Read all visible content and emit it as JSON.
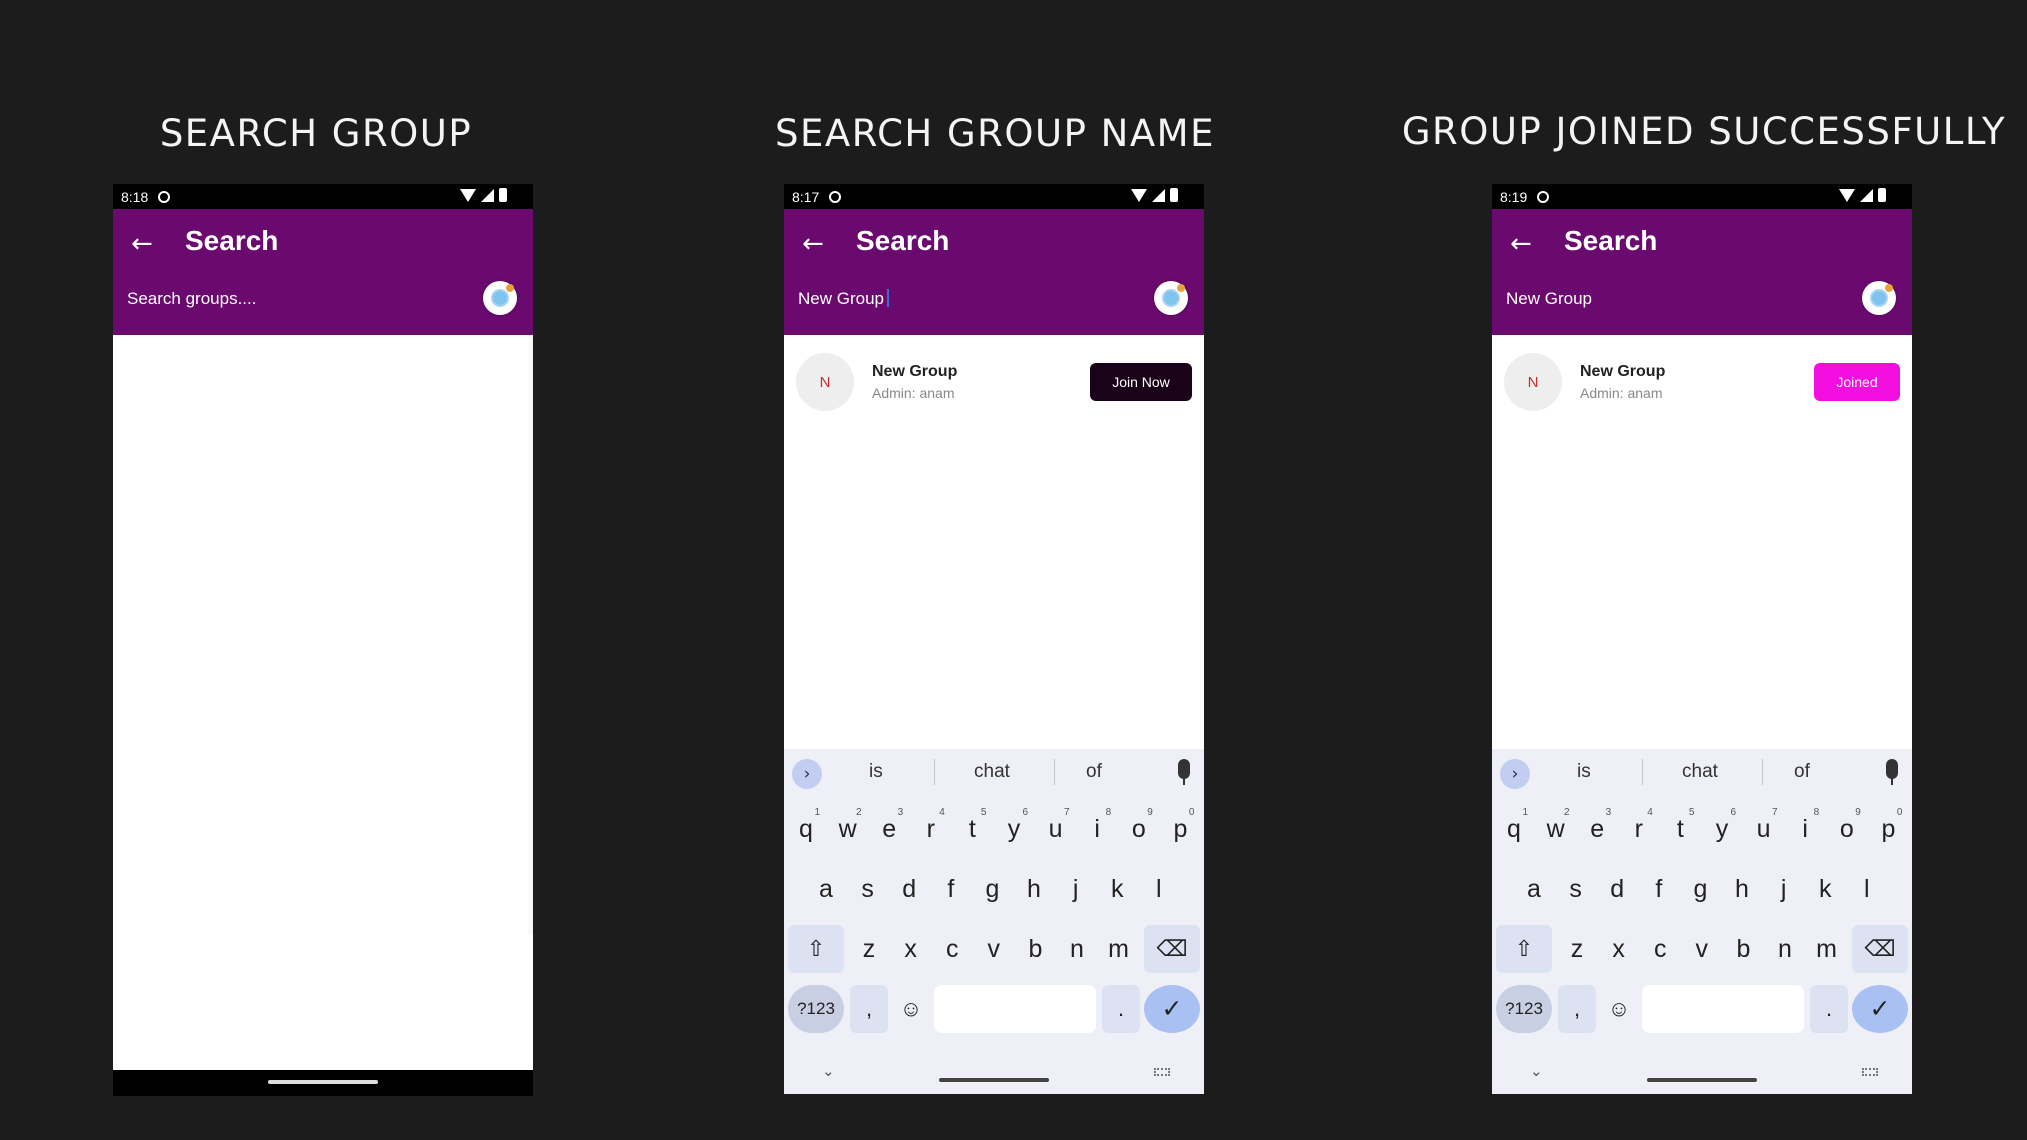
{
  "captions": [
    "SEARCH GROUP",
    "SEARCH GROUP NAME",
    "GROUP JOINED SUCCESSFULLY"
  ],
  "screens": [
    {
      "time": "8:18",
      "title": "Search",
      "query": "Search groups...."
    },
    {
      "time": "8:17",
      "title": "Search",
      "query": "New Group",
      "result": {
        "initial": "N",
        "name": "New Group",
        "admin": "Admin: anam",
        "button": "Join Now"
      }
    },
    {
      "time": "8:19",
      "title": "Search",
      "query": "New Group",
      "result": {
        "initial": "N",
        "name": "New Group",
        "admin": "Admin: anam",
        "button": "Joined"
      }
    }
  ],
  "keyboard": {
    "suggestions": [
      "is",
      "chat",
      "of"
    ],
    "row1": [
      "q",
      "w",
      "e",
      "r",
      "t",
      "y",
      "u",
      "i",
      "o",
      "p"
    ],
    "row1_nums": [
      "1",
      "2",
      "3",
      "4",
      "5",
      "6",
      "7",
      "8",
      "9",
      "0"
    ],
    "row2": [
      "a",
      "s",
      "d",
      "f",
      "g",
      "h",
      "j",
      "k",
      "l"
    ],
    "row3": [
      "z",
      "x",
      "c",
      "v",
      "b",
      "n",
      "m"
    ],
    "num_key": "?123",
    "comma": ",",
    "period": "."
  },
  "colors": {
    "background": "#1c1c1c",
    "appbar": "#6a0a6e",
    "join_button": "#1a0318",
    "joined_button": "#f20fe0",
    "keyboard": "#eff0f7"
  },
  "icons": {
    "back": "back-arrow-icon",
    "search": "search-magnifier-icon",
    "mic": "microphone-icon",
    "shift": "shift-icon",
    "backspace": "backspace-icon",
    "emoji": "emoji-icon",
    "enter": "checkmark-icon"
  }
}
